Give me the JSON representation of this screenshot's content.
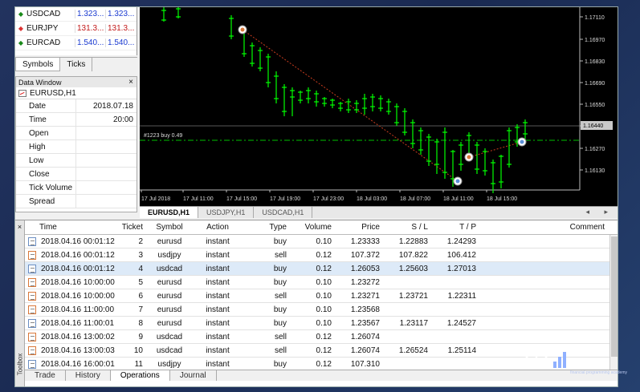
{
  "market_watch": {
    "rows": [
      {
        "dir": "up",
        "symbol": "USDCAD",
        "bid": "1.323...",
        "ask": "1.323..."
      },
      {
        "dir": "dn",
        "symbol": "EURJPY",
        "bid": "131.3...",
        "ask": "131.3..."
      },
      {
        "dir": "up",
        "symbol": "EURCAD",
        "bid": "1.540...",
        "ask": "1.540..."
      }
    ],
    "tabs": [
      "Symbols",
      "Ticks"
    ]
  },
  "data_window": {
    "title": "Data Window",
    "close": "×",
    "symbol": "EURUSD,H1",
    "rows": [
      {
        "key": "Date",
        "value": "2018.07.18"
      },
      {
        "key": "Time",
        "value": "20:00"
      },
      {
        "key": "Open",
        "value": ""
      },
      {
        "key": "High",
        "value": ""
      },
      {
        "key": "Low",
        "value": ""
      },
      {
        "key": "Close",
        "value": ""
      },
      {
        "key": "Tick Volume",
        "value": ""
      },
      {
        "key": "Spread",
        "value": ""
      }
    ]
  },
  "chart": {
    "order_label": "#1223 buy 0.49",
    "current_price": "1.16440",
    "price_ticks": [
      "1.17110",
      "1.16970",
      "1.16830",
      "1.16690",
      "1.16550",
      "1.16410",
      "1.16270",
      "1.16130"
    ],
    "time_ticks": [
      "17 Jul 2018",
      "17 Jul 11:00",
      "17 Jul 15:00",
      "17 Jul 19:00",
      "17 Jul 23:00",
      "18 Jul 03:00",
      "18 Jul 07:00",
      "18 Jul 11:00",
      "18 Jul 15:00"
    ],
    "tabs": [
      "EURUSD,H1",
      "USDJPY,H1",
      "USDCAD,H1"
    ],
    "tab_arrows": "◂ ▸",
    "colors": {
      "bull": "#00ff00",
      "background": "#000000",
      "grid": "#3a3a3a",
      "order_line": "#00c000",
      "trade_line": "#c83c1e"
    }
  },
  "toolbox": {
    "close": "×",
    "side_label": "Toolbox",
    "columns": [
      "Time",
      "Ticket",
      "Symbol",
      "Action",
      "Type",
      "Volume",
      "Price",
      "S / L",
      "T / P",
      "Comment"
    ],
    "rows": [
      {
        "icon": "blue",
        "time": "2018.04.16 00:01:12",
        "ticket": "2",
        "symbol": "eurusd",
        "action": "instant",
        "type": "buy",
        "volume": "0.10",
        "price": "1.23333",
        "sl": "1.22883",
        "tp": "1.24293",
        "comment": ""
      },
      {
        "icon": "orange",
        "time": "2018.04.16 00:01:12",
        "ticket": "3",
        "symbol": "usdjpy",
        "action": "instant",
        "type": "sell",
        "volume": "0.12",
        "price": "107.372",
        "sl": "107.822",
        "tp": "106.412",
        "comment": ""
      },
      {
        "icon": "blue",
        "time": "2018.04.16 00:01:12",
        "ticket": "4",
        "symbol": "usdcad",
        "action": "instant",
        "type": "buy",
        "volume": "0.12",
        "price": "1.26053",
        "sl": "1.25603",
        "tp": "1.27013",
        "comment": ""
      },
      {
        "icon": "orange",
        "time": "2018.04.16 10:00:00",
        "ticket": "5",
        "symbol": "eurusd",
        "action": "instant",
        "type": "buy",
        "volume": "0.10",
        "price": "1.23272",
        "sl": "",
        "tp": "",
        "comment": ""
      },
      {
        "icon": "orange",
        "time": "2018.04.16 10:00:00",
        "ticket": "6",
        "symbol": "eurusd",
        "action": "instant",
        "type": "sell",
        "volume": "0.10",
        "price": "1.23271",
        "sl": "1.23721",
        "tp": "1.22311",
        "comment": ""
      },
      {
        "icon": "orange",
        "time": "2018.04.16 11:00:00",
        "ticket": "7",
        "symbol": "eurusd",
        "action": "instant",
        "type": "buy",
        "volume": "0.10",
        "price": "1.23568",
        "sl": "",
        "tp": "",
        "comment": ""
      },
      {
        "icon": "blue",
        "time": "2018.04.16 11:00:01",
        "ticket": "8",
        "symbol": "eurusd",
        "action": "instant",
        "type": "buy",
        "volume": "0.10",
        "price": "1.23567",
        "sl": "1.23117",
        "tp": "1.24527",
        "comment": ""
      },
      {
        "icon": "orange",
        "time": "2018.04.16 13:00:02",
        "ticket": "9",
        "symbol": "usdcad",
        "action": "instant",
        "type": "sell",
        "volume": "0.12",
        "price": "1.26074",
        "sl": "",
        "tp": "",
        "comment": ""
      },
      {
        "icon": "orange",
        "time": "2018.04.16 13:00:03",
        "ticket": "10",
        "symbol": "usdcad",
        "action": "instant",
        "type": "sell",
        "volume": "0.12",
        "price": "1.26074",
        "sl": "1.26524",
        "tp": "1.25114",
        "comment": ""
      },
      {
        "icon": "blue",
        "time": "2018.04.16 16:00:01",
        "ticket": "11",
        "symbol": "usdjpy",
        "action": "instant",
        "type": "buy",
        "volume": "0.12",
        "price": "107.310",
        "sl": "",
        "tp": "",
        "comment": ""
      }
    ],
    "selected_index": 2,
    "tabs": [
      "Trade",
      "History",
      "Operations",
      "Journal"
    ],
    "active_tab": "Operations"
  },
  "logo": {
    "mark": "{|}",
    "name": "IRAN MQL",
    "tagline": "financial programming academy"
  }
}
